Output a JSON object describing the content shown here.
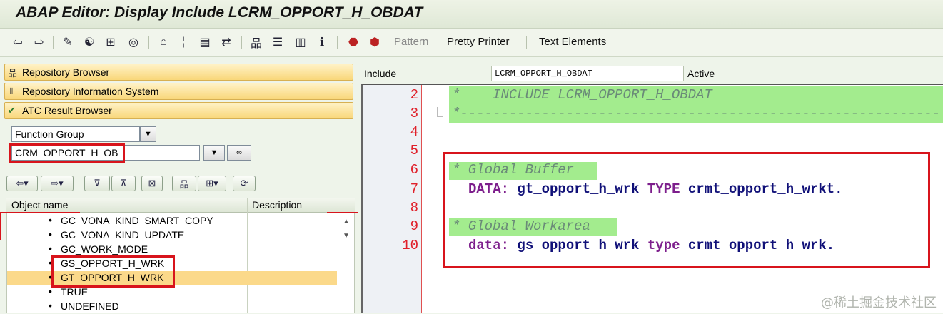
{
  "window": {
    "title": "ABAP Editor: Display Include LCRM_OPPORT_H_OBDAT"
  },
  "toolbar": {
    "icons": [
      "back-icon",
      "forward-icon",
      "check-syntax-icon",
      "where-used-icon",
      "other-object-icon",
      "activate-icon",
      "display-object-list-icon",
      "navigation-window-icon",
      "test-icon",
      "where-used-list-icon",
      "hierarchy-icon",
      "stack-icon",
      "print-icon",
      "info-icon",
      "breakpoint-icon",
      "session-breakpoint-icon"
    ],
    "pattern_label": "Pattern",
    "pretty_printer_label": "Pretty Printer",
    "text_elements_label": "Text Elements"
  },
  "left": {
    "nav": [
      "Repository Browser",
      "Repository Information System",
      "ATC Result Browser"
    ],
    "object_type": "Function Group",
    "object_name": "CRM_OPPORT_H_OB",
    "grid": {
      "col_object": "Object name",
      "col_desc": "Description",
      "rows": [
        "GC_VONA_KIND_SMART_COPY",
        "GC_VONA_KIND_UPDATE",
        "GC_WORK_MODE",
        "GS_OPPORT_H_WRK",
        "GT_OPPORT_H_WRK",
        "TRUE",
        "UNDEFINED"
      ],
      "selected_row": "GT_OPPORT_H_WRK",
      "bullet": "•"
    }
  },
  "right": {
    "include_label": "Include",
    "include_value": "LCRM_OPPORT_H_OBDAT",
    "status": "Active",
    "line_numbers": [
      "2",
      "3",
      "4",
      "5",
      "6",
      "7",
      "8",
      "9",
      "10"
    ],
    "code": {
      "l2": "*    INCLUDE LCRM_OPPORT_H_OBDAT",
      "l3": "*-----------------------------------------------------------",
      "l6": "* Global Buffer",
      "l7_kw": "DATA:",
      "l7_name": "gt_opport_h_wrk",
      "l7_type": "TYPE",
      "l7_rest": "crmt_opport_h_wrkt.",
      "l9": "* Global Workarea",
      "l10_kw": "data:",
      "l10_name": "gs_opport_h_wrk",
      "l10_type": "type",
      "l10_rest": "crmt_opport_h_wrk."
    }
  },
  "watermark": "@稀土掘金技术社区",
  "colors": {
    "highlight_red": "#d8141c",
    "comment_bg": "#a3ec8e",
    "keyword": "#7d1e8c"
  }
}
